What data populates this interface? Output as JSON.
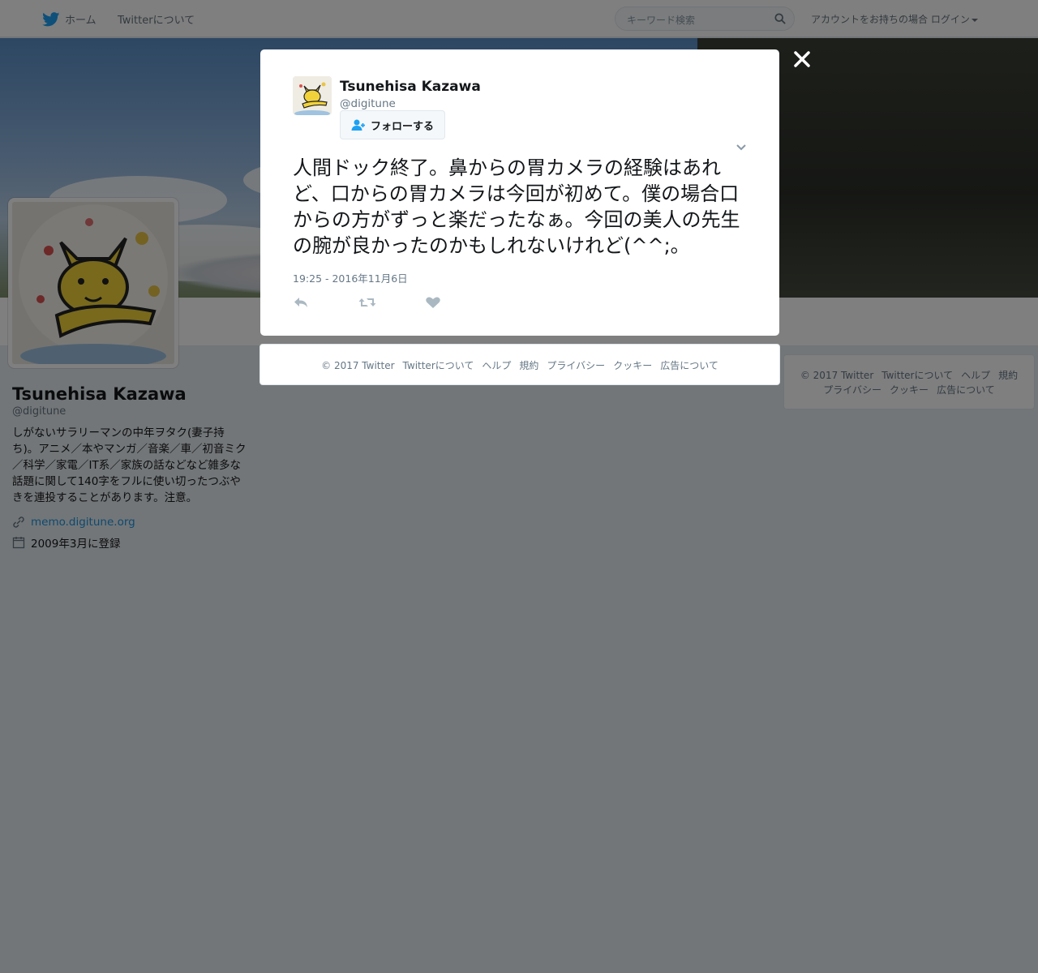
{
  "nav": {
    "home_label": "ホーム",
    "about_label": "Twitterについて",
    "search_placeholder": "キーワード検索",
    "login_prefix": "アカウントをお持ちの場合",
    "login_label": "ログイン"
  },
  "profile": {
    "name": "Tsunehisa Kazawa",
    "handle": "@digitune",
    "bio": "しがないサラリーマンの中年ヲタク(妻子持ち)。アニメ／本やマンガ／音楽／車／初音ミク／科学／家電／IT系／家族の話などなど雑多な話題に関して140字をフルに使い切ったつぶやきを連投することがあります。注意。",
    "website": "memo.digitune.org",
    "joined": "2009年3月に登録"
  },
  "sidebar_footer": {
    "items": [
      "© 2017 Twitter",
      "Twitterについて",
      "ヘルプ",
      "規約",
      "プライバシー",
      "クッキー",
      "広告について"
    ]
  },
  "modal": {
    "close_glyph": "✕",
    "name": "Tsunehisa Kazawa",
    "handle": "@digitune",
    "follow_label": "フォローする",
    "tweet_text": "人間ドック終了。鼻からの胃カメラの経験はあれど、口からの胃カメラは今回が初めて。僕の場合口からの方がずっと楽だったなぁ。今回の美人の先生の腕が良かったのかもしれないけれど(^^;。",
    "timestamp": "19:25 - 2016年11月6日"
  },
  "modal_footer": {
    "items": [
      "© 2017 Twitter",
      "Twitterについて",
      "ヘルプ",
      "規約",
      "プライバシー",
      "クッキー",
      "広告について"
    ]
  },
  "colors": {
    "twitter_blue": "#1da1f2",
    "link_blue": "#1b95e0",
    "overlay": "rgba(0,0,0,0.5)"
  }
}
